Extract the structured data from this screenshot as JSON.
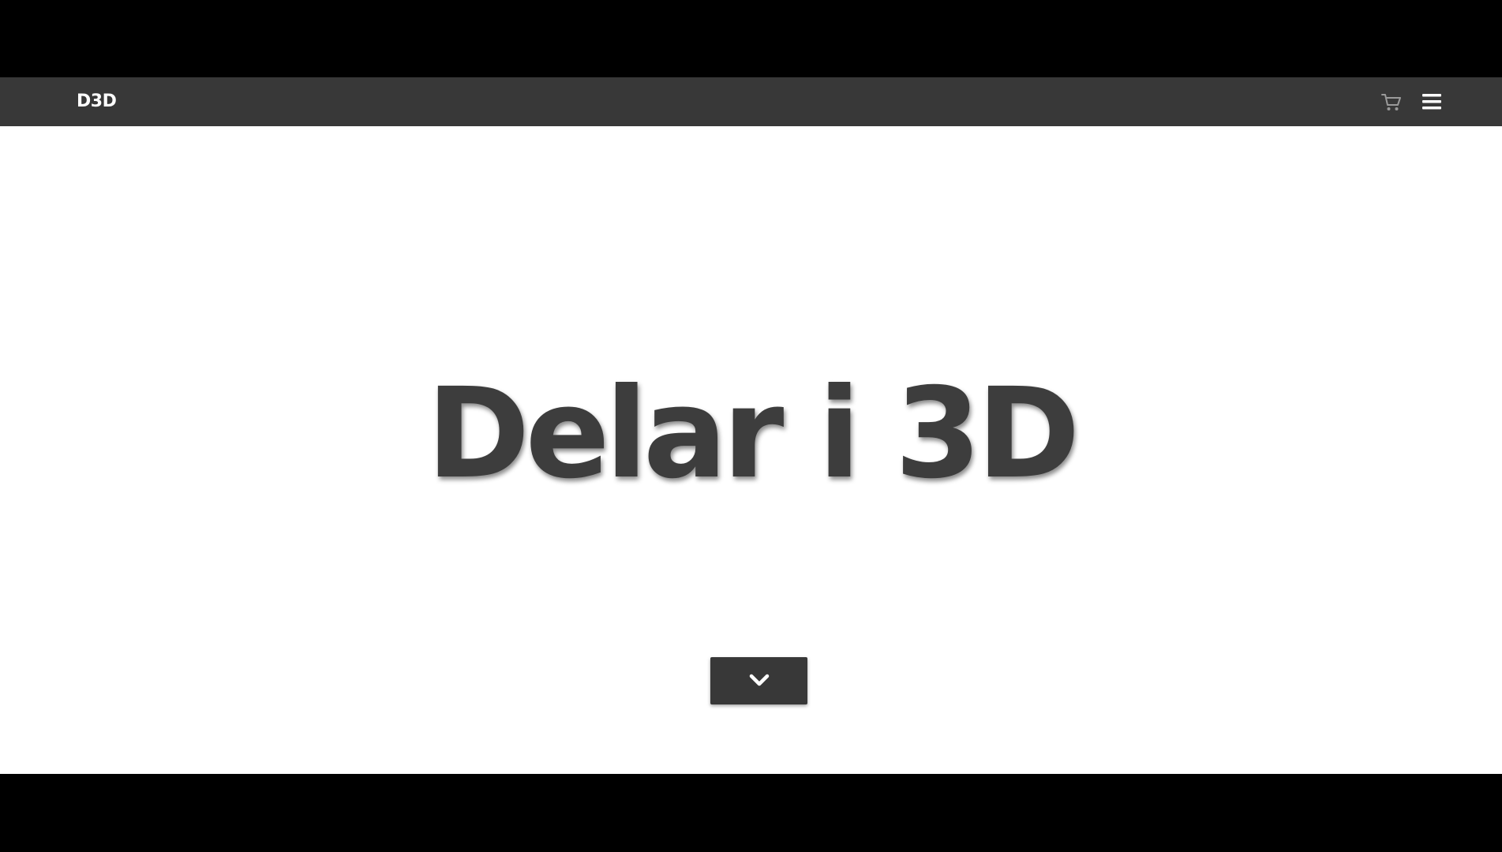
{
  "navbar": {
    "brand": "D3D",
    "icons": {
      "cart": "shopping-cart-icon",
      "menu": "hamburger-menu-icon"
    },
    "background_color": "#383838"
  },
  "hero": {
    "title": "Delar i 3D",
    "title_color": "#3d3d3d",
    "scroll_button_icon": "chevron-down-icon"
  }
}
